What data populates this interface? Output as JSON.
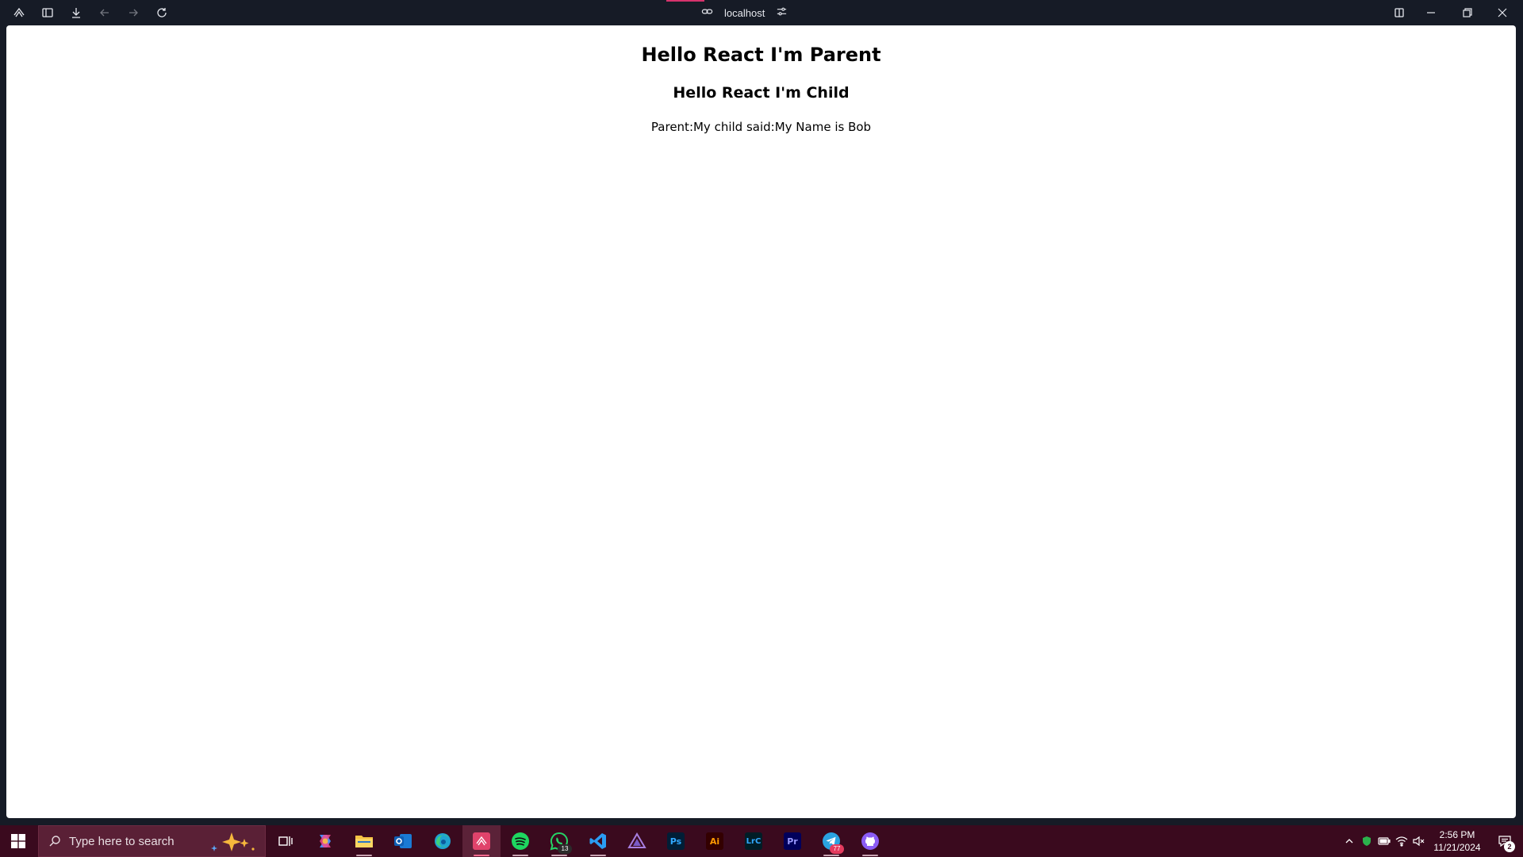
{
  "browser": {
    "url": "localhost",
    "icons": [
      "browser-logo-icon",
      "sidebar-toggle-icon",
      "download-icon",
      "back-icon",
      "forward-icon",
      "reload-icon",
      "link-icon",
      "site-settings-icon",
      "split-view-icon",
      "minimize-icon",
      "restore-icon",
      "close-icon"
    ]
  },
  "page": {
    "heading_parent": "Hello React I'm Parent",
    "heading_child": "Hello React I'm Child",
    "message": "Parent:My child said:My Name is Bob"
  },
  "taskbar": {
    "search_placeholder": "Type here to search",
    "apps": [
      {
        "name": "Task View"
      },
      {
        "name": "Copilot"
      },
      {
        "name": "File Explorer"
      },
      {
        "name": "Outlook"
      },
      {
        "name": "Microsoft Edge"
      },
      {
        "name": "Browser"
      },
      {
        "name": "Spotify"
      },
      {
        "name": "WhatsApp",
        "badge": "13"
      },
      {
        "name": "Visual Studio Code"
      },
      {
        "name": "Affinity"
      },
      {
        "name": "Photoshop",
        "label": "Ps"
      },
      {
        "name": "Illustrator",
        "label": "Ai"
      },
      {
        "name": "Lightroom Classic",
        "label": "LrC"
      },
      {
        "name": "Premiere Pro",
        "label": "Pr"
      },
      {
        "name": "Telegram",
        "badge": "77"
      },
      {
        "name": "GitHub Desktop"
      }
    ],
    "clock_time": "2:56 PM",
    "clock_date": "11/21/2024",
    "notifications_count": "2",
    "colors": {
      "taskbar": "#3a0a1e",
      "accent": "#d6336c"
    }
  }
}
